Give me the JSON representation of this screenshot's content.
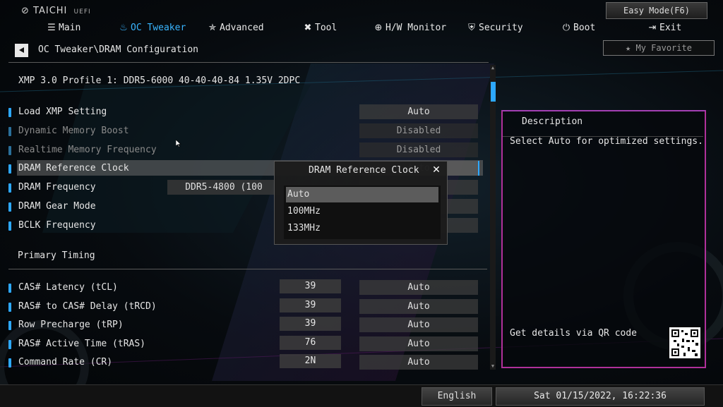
{
  "brand": {
    "name": "TAICHI",
    "sub": "UEFI"
  },
  "header": {
    "easy_mode": "Easy Mode(F6)",
    "favorite": "My Favorite"
  },
  "nav": [
    {
      "label": "Main",
      "icon": "list-icon",
      "active": false
    },
    {
      "label": "OC Tweaker",
      "icon": "flame-icon",
      "active": true
    },
    {
      "label": "Advanced",
      "icon": "star-icon",
      "active": false
    },
    {
      "label": "Tool",
      "icon": "tools-icon",
      "active": false
    },
    {
      "label": "H/W Monitor",
      "icon": "monitor-icon",
      "active": false
    },
    {
      "label": "Security",
      "icon": "shield-icon",
      "active": false
    },
    {
      "label": "Boot",
      "icon": "power-icon",
      "active": false
    },
    {
      "label": "Exit",
      "icon": "exit-icon",
      "active": false
    }
  ],
  "breadcrumb": "OC Tweaker\\DRAM Configuration",
  "xmp_profile": "XMP 3.0 Profile 1: DDR5-6000 40-40-40-84 1.35V 2DPC",
  "settings": [
    {
      "label": "Load XMP Setting",
      "value": "Auto"
    },
    {
      "label": "Dynamic Memory Boost",
      "value": "Disabled"
    },
    {
      "label": "Realtime Memory Frequency",
      "value": "Disabled"
    },
    {
      "label": "DRAM Reference Clock",
      "value": "Auto"
    },
    {
      "label": "DRAM Frequency",
      "value": "DDR5-4800 (100"
    },
    {
      "label": "DRAM Gear Mode",
      "value": ""
    },
    {
      "label": "BCLK Frequency",
      "value": ""
    }
  ],
  "primary_timing": {
    "title": "Primary Timing",
    "rows": [
      {
        "label": "CAS# Latency (tCL)",
        "current": "39",
        "value": "Auto"
      },
      {
        "label": "RAS# to CAS# Delay (tRCD)",
        "current": "39",
        "value": "Auto"
      },
      {
        "label": "Row Precharge (tRP)",
        "current": "39",
        "value": "Auto"
      },
      {
        "label": "RAS# Active Time (tRAS)",
        "current": "76",
        "value": "Auto"
      },
      {
        "label": "Command Rate (CR)",
        "current": "2N",
        "value": "Auto"
      }
    ]
  },
  "description": {
    "title": "Description",
    "text": "Select Auto for optimized settings.",
    "qr_label": "Get details via QR code"
  },
  "popup": {
    "title": "DRAM Reference Clock",
    "options": [
      "Auto",
      "100MHz",
      "133MHz"
    ],
    "selected_index": 0
  },
  "status": {
    "language": "English",
    "datetime": "Sat 01/15/2022, 16:22:36"
  },
  "colors": {
    "accent": "#2da8ff",
    "panel_border": "#b0309a"
  }
}
